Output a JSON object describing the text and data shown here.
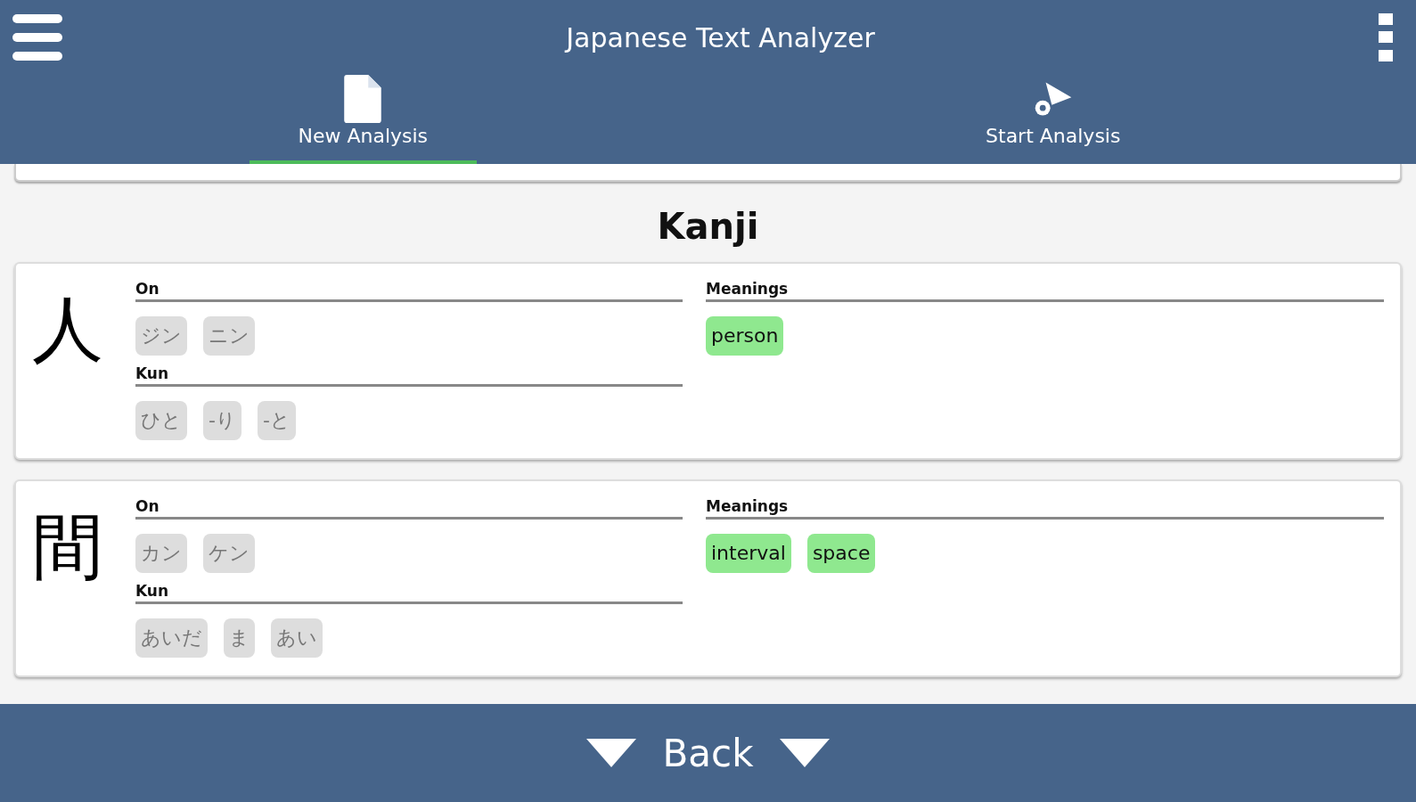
{
  "app_bar": {
    "title": "Japanese Text Analyzer"
  },
  "tabs": [
    {
      "label": "New Analysis",
      "selected": true
    },
    {
      "label": "Start Analysis",
      "selected": false
    }
  ],
  "section_title": "Kanji",
  "kanji": [
    {
      "character": "人",
      "on_label": "On",
      "on": [
        "ジン",
        "ニン"
      ],
      "kun_label": "Kun",
      "kun": [
        "ひと",
        "-り",
        "-と"
      ],
      "meanings_label": "Meanings",
      "meanings": [
        "person"
      ]
    },
    {
      "character": "間",
      "on_label": "On",
      "on": [
        "カン",
        "ケン"
      ],
      "kun_label": "Kun",
      "kun": [
        "あいだ",
        "ま",
        "あい"
      ],
      "meanings_label": "Meanings",
      "meanings": [
        "interval",
        "space"
      ]
    }
  ],
  "footer": {
    "button": "Back"
  }
}
